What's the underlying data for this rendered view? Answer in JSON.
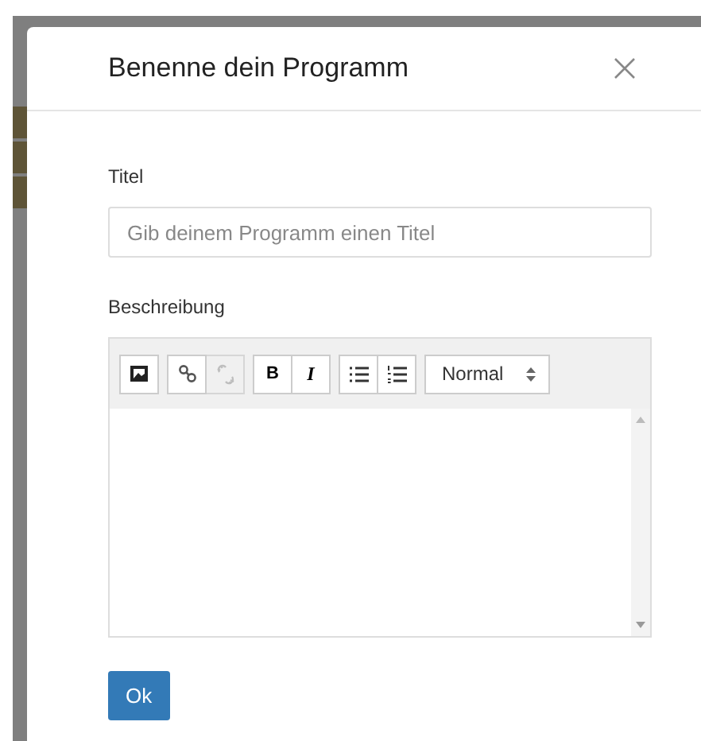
{
  "dialog": {
    "title": "Benenne dein Programm",
    "fields": [
      {
        "label": "Titel",
        "placeholder": "Gib deinem Programm einen Titel"
      }
    ],
    "editor": {
      "label": "Beschreibung",
      "toolbar": [
        [
          {
            "kind": "image",
            "disabled": false
          }
        ],
        [
          {
            "kind": "link",
            "disabled": false
          },
          {
            "kind": "unlink",
            "disabled": true
          }
        ],
        [
          {
            "kind": "bold",
            "label": "B",
            "disabled": false
          },
          {
            "kind": "italic",
            "label": "I",
            "disabled": false
          }
        ],
        [
          {
            "kind": "bullets",
            "disabled": false
          },
          {
            "kind": "numbers",
            "disabled": false
          }
        ]
      ],
      "format": {
        "value": "Normal"
      }
    },
    "buttons": [
      {
        "label": "Ok"
      }
    ]
  }
}
